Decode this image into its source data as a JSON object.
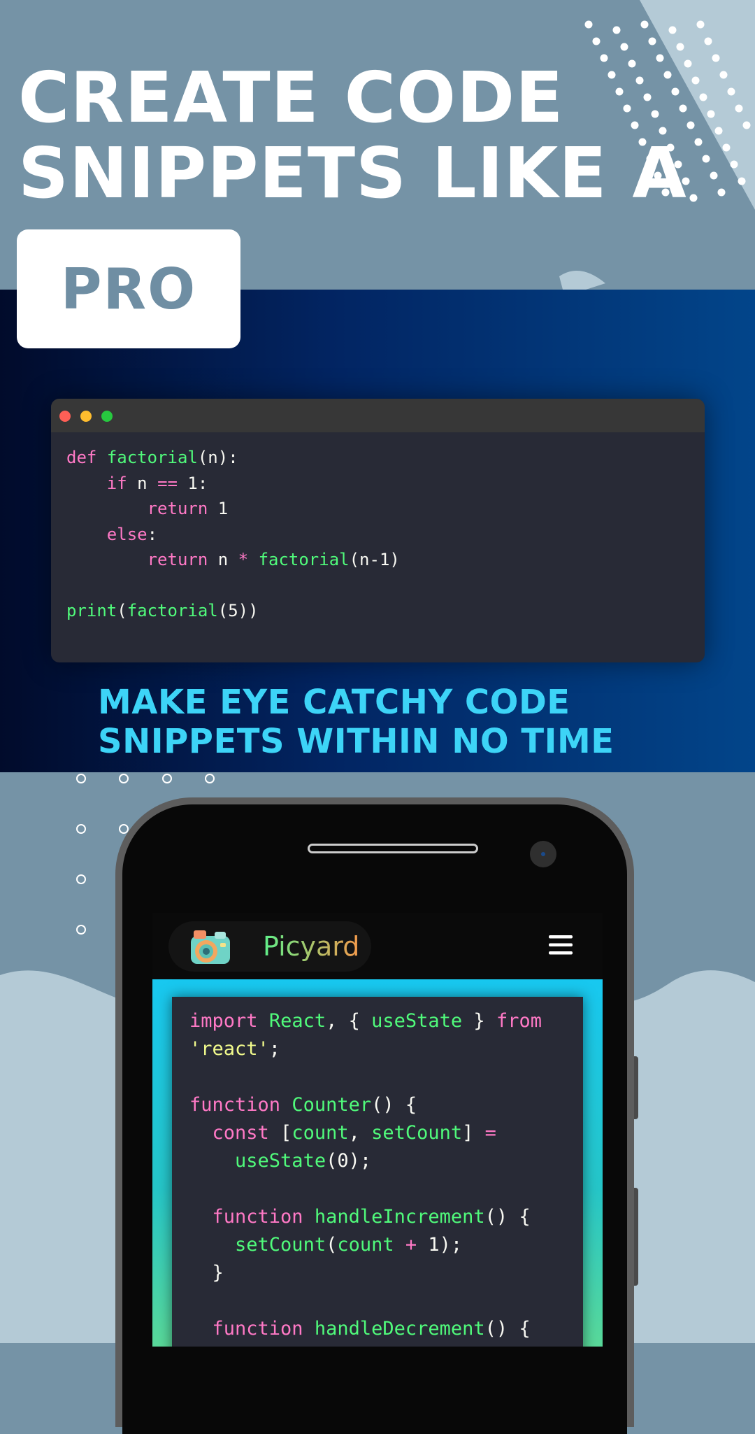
{
  "hero": {
    "headline_line1": "CREATE CODE",
    "headline_line2": "SNIPPETS LIKE A",
    "badge": "PRO"
  },
  "editor": {
    "language": "python",
    "code_lines": [
      "def factorial(n):",
      "    if n == 1:",
      "        return 1",
      "    else:",
      "        return n * factorial(n-1)",
      "",
      "print(factorial(5))"
    ]
  },
  "tagline": {
    "line1": "MAKE EYE CATCHY CODE",
    "line2": "SNIPPETS WITHIN NO TIME"
  },
  "phone_app": {
    "app_name": "Picyard",
    "logo_icon": "camera-icon",
    "menu_icon": "hamburger-menu-icon",
    "code_lines": [
      "import React, { useState } from",
      "'react';",
      "",
      "function Counter() {",
      "  const [count, setCount] =",
      "    useState(0);",
      "",
      "  function handleIncrement() {",
      "    setCount(count + 1);",
      "  }",
      "",
      "  function handleDecrement() {"
    ]
  },
  "colors": {
    "slate_bg": "#7593a6",
    "dark_band_start": "#010b2b",
    "dark_band_end": "#02458a",
    "tagline": "#3dd4f7",
    "editor_bg": "#282a36",
    "keyword": "#ff79c6",
    "function": "#50fa7b",
    "string": "#f1fa8c",
    "dot_red": "#ff5f56",
    "dot_yellow": "#ffbd2e",
    "dot_green": "#27c93f"
  }
}
